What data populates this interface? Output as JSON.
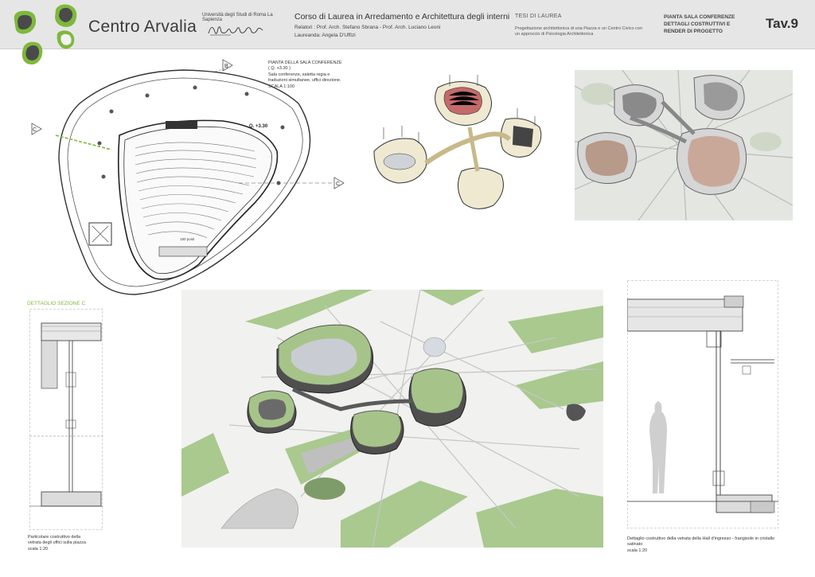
{
  "header": {
    "brand": "Centro Arvalia",
    "university": "Università degli Studi di Roma La Sapienza",
    "faculty_signature": "Architettura Valle Giulia",
    "course_title": "Corso di Laurea  in Arredamento e Architettura degli interni",
    "advisors": "Relatori : Prof. Arch. Stefano Sbrana - Prof. Arch. Luciano Leoni",
    "student": "Laureanda: Angela D'Uffizi",
    "thesis_label": "TESI DI LAUREA",
    "thesis_description": "Progettazione architettonica di una Piazza e un Centro Civico con un approccio di Psicologia Architettonica",
    "sheet_title_line1": "PIANTA SALA CONFERENZE",
    "sheet_title_line2": "DETTAGLI COSTRUTTIVI E",
    "sheet_title_line3": "RENDER DI PROGETTO",
    "sheet_number": "Tav.9"
  },
  "plan": {
    "note_line1": "PIANTA DELLA SALA CONFERENZE",
    "note_line2": "( Q. +3.30 )",
    "note_line3": "Sala conferenze, saletta regia e",
    "note_line4": "traduzioni simultanee, uffici direzione.",
    "note_line5": "SCALA 1:100",
    "level_label": "Q. +3.30",
    "seats_label": "180 posti",
    "marker_b": "B",
    "marker_c": "C"
  },
  "section": {
    "title": "DETTAGLIO SEZIONE C",
    "caption_line1": "Particolare costruttivo della",
    "caption_line2": "vetrata degli uffici sulla piazza",
    "caption_line3": "scala 1:20"
  },
  "detail": {
    "caption_line1": "Dettaglio costruttivo della vetrata della Hall  d'ingresso  - frangisole in cristallo",
    "caption_line2": "satinato",
    "caption_line3": "scala 1:20"
  },
  "colors": {
    "header_bg": "#e6e6e6",
    "accent_green": "#7fb83d",
    "logo_dark": "#4a4a4a",
    "roof_green": "#a6c48a",
    "lawn_green": "#a9c98f"
  }
}
